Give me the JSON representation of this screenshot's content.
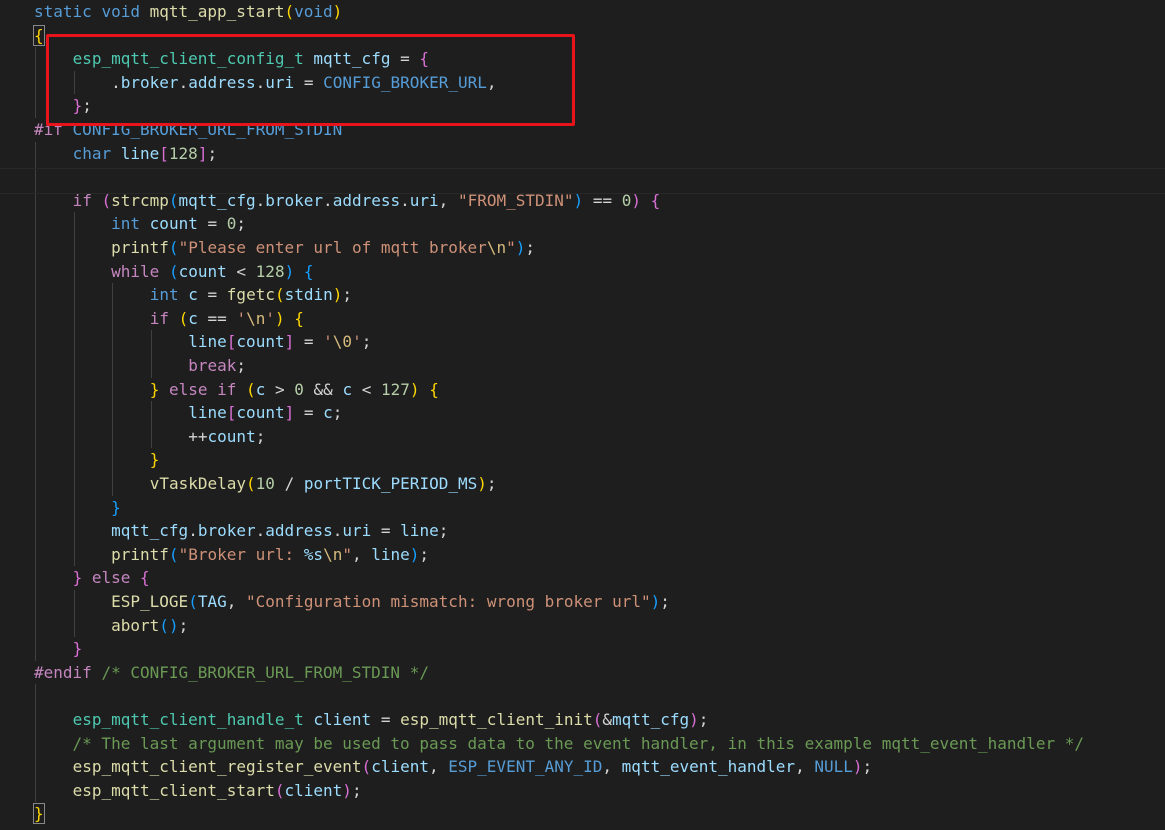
{
  "code": {
    "lines": [
      "static void mqtt_app_start(void)",
      "{",
      "    esp_mqtt_client_config_t mqtt_cfg = {",
      "        .broker.address.uri = CONFIG_BROKER_URL,",
      "    };",
      "#if CONFIG_BROKER_URL_FROM_STDIN",
      "    char line[128];",
      "",
      "    if (strcmp(mqtt_cfg.broker.address.uri, \"FROM_STDIN\") == 0) {",
      "        int count = 0;",
      "        printf(\"Please enter url of mqtt broker\\n\");",
      "        while (count < 128) {",
      "            int c = fgetc(stdin);",
      "            if (c == '\\n') {",
      "                line[count] = '\\0';",
      "                break;",
      "            } else if (c > 0 && c < 127) {",
      "                line[count] = c;",
      "                ++count;",
      "            }",
      "            vTaskDelay(10 / portTICK_PERIOD_MS);",
      "        }",
      "        mqtt_cfg.broker.address.uri = line;",
      "        printf(\"Broker url: %s\\n\", line);",
      "    } else {",
      "        ESP_LOGE(TAG, \"Configuration mismatch: wrong broker url\");",
      "        abort();",
      "    }",
      "#endif /* CONFIG_BROKER_URL_FROM_STDIN */",
      "",
      "    esp_mqtt_client_handle_t client = esp_mqtt_client_init(&mqtt_cfg);",
      "    /* The last argument may be used to pass data to the event handler, in this example mqtt_event_handler */",
      "    esp_mqtt_client_register_event(client, ESP_EVENT_ANY_ID, mqtt_event_handler, NULL);",
      "    esp_mqtt_client_start(client);",
      "}"
    ]
  },
  "highlight": {
    "color": "#e8141b",
    "target": "mqtt_cfg initializer (lines 3-5)"
  },
  "theme": {
    "background": "#1e1e1e",
    "keyword": "#569cd6",
    "control": "#c586c0",
    "function": "#dcdcaa",
    "variable": "#9cdcfe",
    "type": "#4ec9b0",
    "number": "#b5cea8",
    "string": "#ce9178",
    "comment": "#6a9955"
  }
}
